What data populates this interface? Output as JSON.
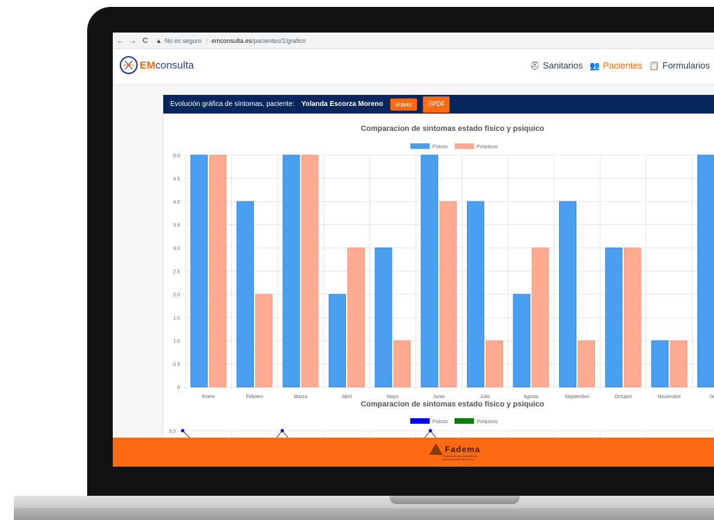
{
  "browser": {
    "back": "←",
    "forward": "→",
    "reload": "C",
    "insecure_label": "No es seguro",
    "url_domain": "emconsulta.es",
    "url_path": "/pacientes/1/grafico"
  },
  "app": {
    "logo_em": "EM",
    "logo_rest": "consulta",
    "nav": [
      {
        "label": "Sanitarios",
        "icon": "user-md-icon"
      },
      {
        "label": "Pacientes",
        "icon": "users-icon"
      },
      {
        "label": "Formularios",
        "icon": "clipboard-icon"
      }
    ]
  },
  "card": {
    "title_prefix": "Evolución gráfica de síntomas, paciente:",
    "patient_name": "Yolanda Escorza Moreno",
    "back_button": "Volver",
    "pdf_button": "PDF"
  },
  "footer": {
    "logo_text": "Fadema",
    "logo_sub": "Federación asociaciones de ESCLEROSIS MÚLTIPLE"
  },
  "colors": {
    "fisicos": "#4a9ff1",
    "psiquicos": "#ffab91",
    "fisicos2": "#0000ff",
    "psiquicos2": "#008000",
    "accent": "#ff6a13",
    "navy": "#07275c"
  },
  "chart_data": [
    {
      "type": "bar",
      "title": "Comparacion de sintomas estado fisico y psiquico",
      "categories": [
        "Enero",
        "Febrero",
        "Marzo",
        "Abril",
        "Mayo",
        "Junio",
        "Julio",
        "Agosto",
        "Septiembre",
        "Octubre",
        "Noviembre",
        "Dicie"
      ],
      "series": [
        {
          "name": "Físicos",
          "values": [
            5,
            4,
            5,
            2,
            3,
            5,
            4,
            2,
            4,
            3,
            1,
            5
          ]
        },
        {
          "name": "Psíquicos",
          "values": [
            5,
            2,
            5,
            3,
            1,
            4,
            1,
            3,
            1,
            3,
            1,
            null
          ]
        }
      ],
      "y_ticks": [
        "0",
        "0.5",
        "1.0",
        "1.5",
        "2.0",
        "2.5",
        "3.0",
        "3.5",
        "4.0",
        "4.5",
        "5.0"
      ],
      "ylim": [
        0,
        5
      ],
      "legend": "top",
      "grid": true
    },
    {
      "type": "line",
      "title": "Comparacion de sintomas estado fisico y psiquico",
      "series": [
        {
          "name": "Físicos"
        },
        {
          "name": "Psíquicos"
        }
      ],
      "y_ticks": [
        "5,0"
      ],
      "legend": "top"
    }
  ]
}
